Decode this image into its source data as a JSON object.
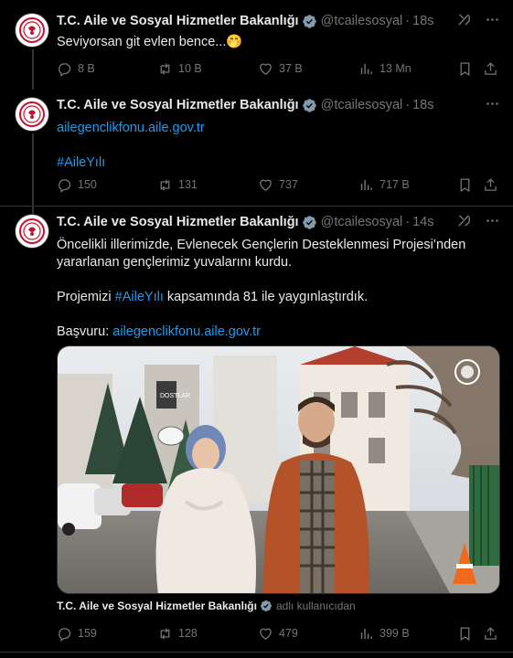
{
  "tweets": [
    {
      "author": "T.C. Aile ve Sosyal Hizmetler Bakanlığı",
      "handle": "@tcailesosyal",
      "time": "18s",
      "text": "Seviyorsan git evlen bence...",
      "emoji": "🤭",
      "stats": {
        "replies": "8 B",
        "reposts": "10 B",
        "likes": "37 B",
        "views": "13 Mn"
      }
    },
    {
      "author": "T.C. Aile ve Sosyal Hizmetler Bakanlığı",
      "handle": "@tcailesosyal",
      "time": "18s",
      "link": "ailegenclikfonu.aile.gov.tr",
      "hashtag": "#AileYılı",
      "stats": {
        "replies": "150",
        "reposts": "131",
        "likes": "737",
        "views": "717 B"
      }
    },
    {
      "author": "T.C. Aile ve Sosyal Hizmetler Bakanlığı",
      "handle": "@tcailesosyal",
      "time": "14s",
      "line1": "Öncelikli illerimizde, Evlenecek Gençlerin Desteklenmesi Projesi’nden",
      "line2": "yararlanan gençlerimiz yuvalarını kurdu.",
      "p2_before": "Projemizi ",
      "p2_hashtag": "#AileYılı",
      "p2_after": " kapsamında 81 ile yaygınlaştırdık.",
      "p3_label": "Başvuru: ",
      "p3_link": "ailegenclikfonu.aile.gov.tr",
      "media_caption_name": "T.C. Aile ve Sosyal Hizmetler Bakanlığı",
      "media_caption_suffix": "adlı kullanıcıdan",
      "media_sign": "DOSTLAR",
      "stats": {
        "replies": "159",
        "reposts": "128",
        "likes": "479",
        "views": "399 B"
      }
    }
  ],
  "colors": {
    "accent": "#1d9bf0",
    "muted": "#71767b",
    "verified": "#829aab",
    "background": "#000000"
  }
}
